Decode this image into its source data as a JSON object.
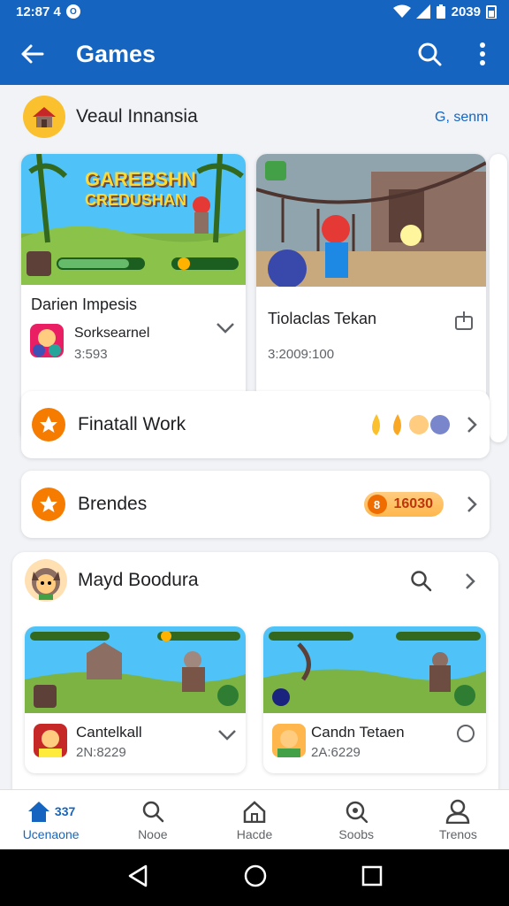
{
  "status_bar": {
    "time": "12:87 4",
    "battery": "2039",
    "notif_glyph": "O"
  },
  "app_bar": {
    "title": "Games"
  },
  "section1": {
    "title": "Veaul Innansia",
    "link": "G, senm",
    "games": [
      {
        "banner_text_1": "GAREBSHN",
        "banner_text_2": "CREDUSHAN",
        "title": "Darien Impesis",
        "subtitle": "Sorksearnel",
        "meta": "3:593"
      },
      {
        "title": "Tiolaclas Tekan",
        "meta": "3:2009:100"
      }
    ]
  },
  "rows": [
    {
      "title": "Finatall Work"
    },
    {
      "title": "Brendes",
      "badge_coin": "8",
      "badge_value": "16030"
    }
  ],
  "section2": {
    "title": "Mayd Boodura",
    "games": [
      {
        "title": "Cantelkall",
        "meta": "2N:8229"
      },
      {
        "title": "Candn Tetaen",
        "meta": "2A:6229"
      }
    ]
  },
  "bottom_nav": {
    "badge": "337",
    "items": [
      "Ucenaone",
      "Nooe",
      "Hacde",
      "Soobs",
      "Trenos"
    ]
  },
  "colors": {
    "primary": "#1565c0",
    "accent": "#f57c00"
  }
}
